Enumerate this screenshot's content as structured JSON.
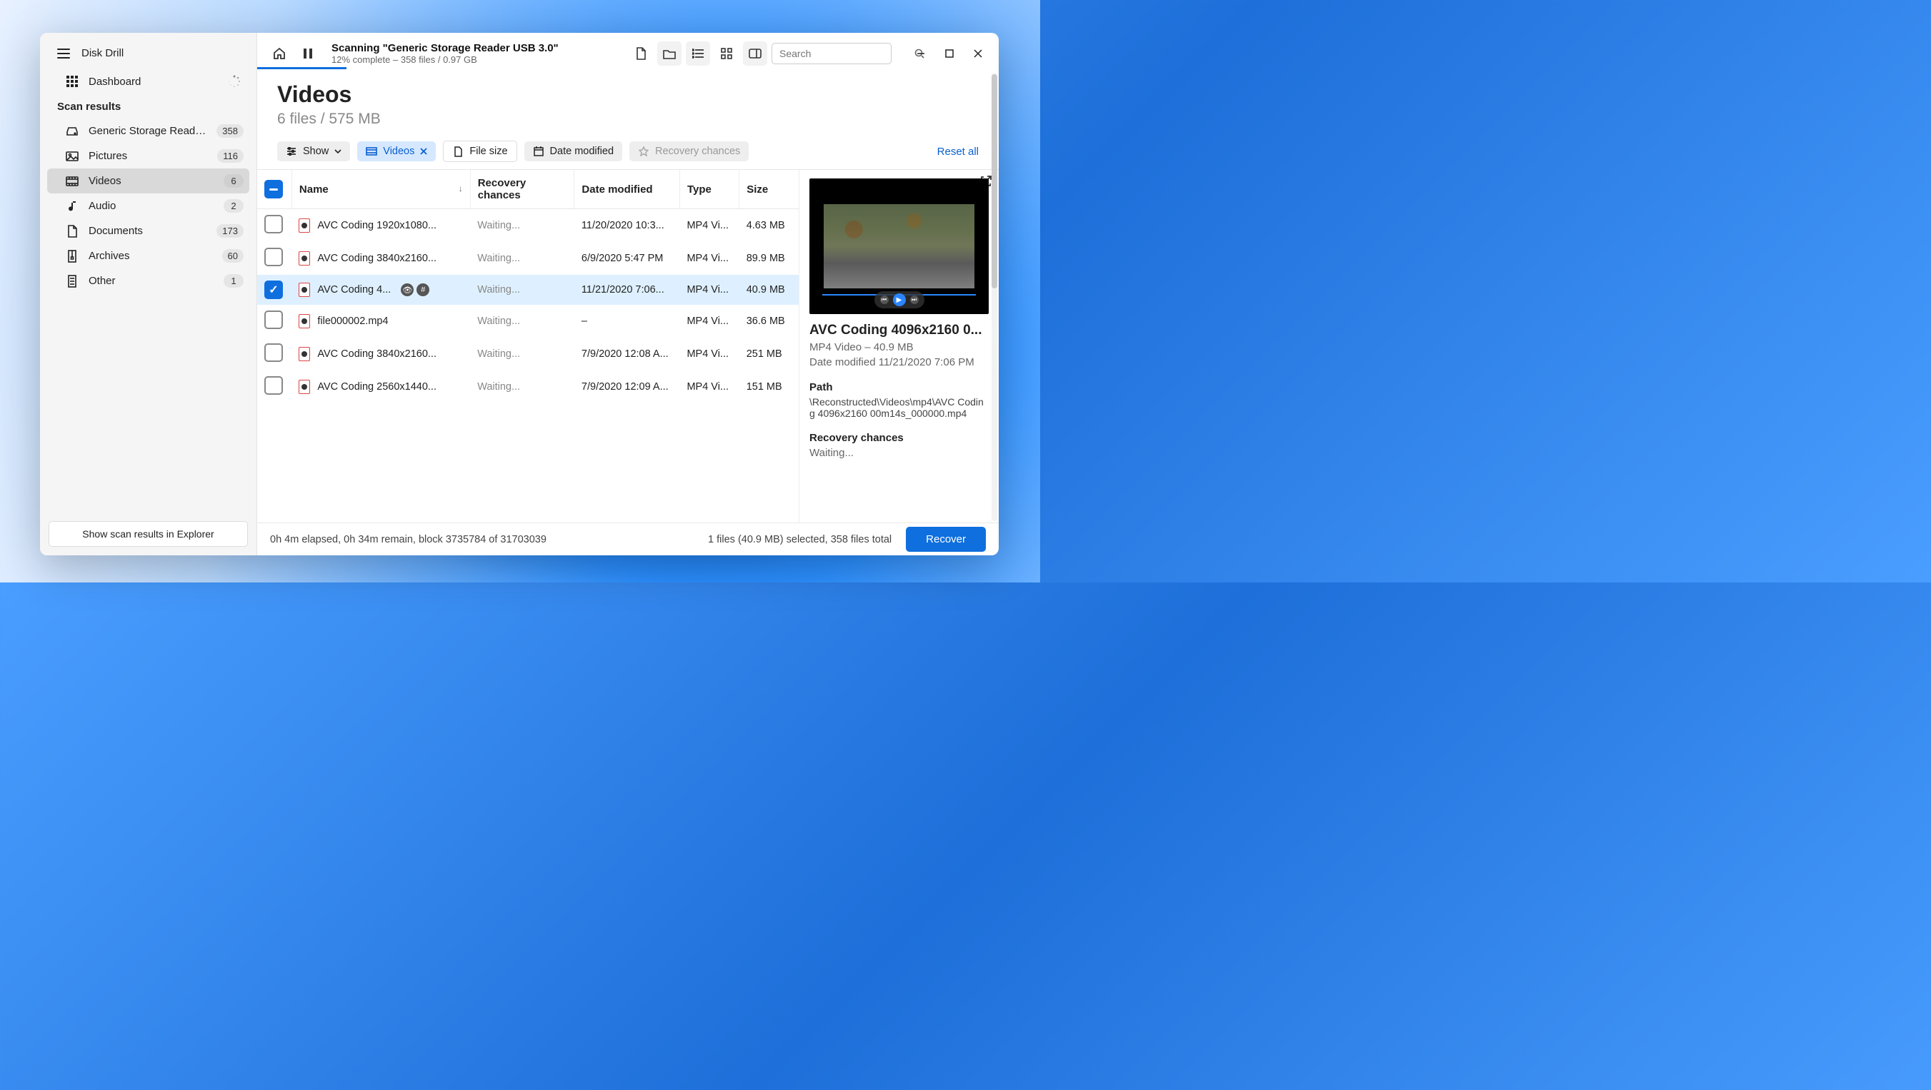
{
  "app": {
    "title": "Disk Drill"
  },
  "sidebar": {
    "dashboard": "Dashboard",
    "section": "Scan results",
    "items": [
      {
        "label": "Generic Storage Reader...",
        "count": "358"
      },
      {
        "label": "Pictures",
        "count": "116"
      },
      {
        "label": "Videos",
        "count": "6"
      },
      {
        "label": "Audio",
        "count": "2"
      },
      {
        "label": "Documents",
        "count": "173"
      },
      {
        "label": "Archives",
        "count": "60"
      },
      {
        "label": "Other",
        "count": "1"
      }
    ],
    "explorer_btn": "Show scan results in Explorer"
  },
  "scan": {
    "title": "Scanning \"Generic Storage Reader USB 3.0\"",
    "subtitle": "12% complete – 358 files / 0.97 GB"
  },
  "search": {
    "placeholder": "Search"
  },
  "content": {
    "title": "Videos",
    "subtitle": "6 files / 575 MB"
  },
  "filters": {
    "show": "Show",
    "videos": "Videos",
    "filesize": "File size",
    "datemod": "Date modified",
    "recovery": "Recovery chances",
    "reset": "Reset all"
  },
  "columns": {
    "name": "Name",
    "recovery": "Recovery chances",
    "date": "Date modified",
    "type": "Type",
    "size": "Size"
  },
  "rows": [
    {
      "name": "AVC Coding 1920x1080...",
      "rec": "Waiting...",
      "date": "11/20/2020 10:3...",
      "type": "MP4 Vi...",
      "size": "4.63 MB",
      "sel": false
    },
    {
      "name": "AVC Coding 3840x2160...",
      "rec": "Waiting...",
      "date": "6/9/2020 5:47 PM",
      "type": "MP4 Vi...",
      "size": "89.9 MB",
      "sel": false
    },
    {
      "name": "AVC Coding 4...",
      "rec": "Waiting...",
      "date": "11/21/2020 7:06...",
      "type": "MP4 Vi...",
      "size": "40.9 MB",
      "sel": true,
      "icons": true
    },
    {
      "name": "file000002.mp4",
      "rec": "Waiting...",
      "date": "–",
      "type": "MP4 Vi...",
      "size": "36.6 MB",
      "sel": false
    },
    {
      "name": "AVC Coding 3840x2160...",
      "rec": "Waiting...",
      "date": "7/9/2020 12:08 A...",
      "type": "MP4 Vi...",
      "size": "251 MB",
      "sel": false
    },
    {
      "name": "AVC Coding 2560x1440...",
      "rec": "Waiting...",
      "date": "7/9/2020 12:09 A...",
      "type": "MP4 Vi...",
      "size": "151 MB",
      "sel": false
    }
  ],
  "preview": {
    "title": "AVC Coding 4096x2160 0...",
    "type_size": "MP4 Video – 40.9 MB",
    "modified": "Date modified 11/21/2020 7:06 PM",
    "path_label": "Path",
    "path": "\\Reconstructed\\Videos\\mp4\\AVC Coding 4096x2160 00m14s_000000.mp4",
    "recovery_label": "Recovery chances",
    "recovery_value": "Waiting..."
  },
  "status": {
    "elapsed": "0h 4m elapsed, 0h 34m remain, block 3735784 of 31703039",
    "selection": "1 files (40.9 MB) selected, 358 files total",
    "recover": "Recover"
  }
}
